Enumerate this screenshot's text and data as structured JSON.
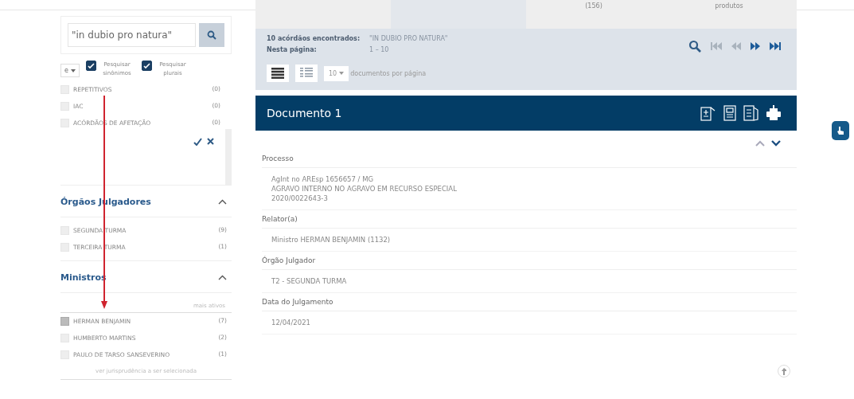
{
  "tabs": [
    {
      "label": "(156)",
      "selected": false
    },
    {
      "label": "produtos",
      "selected": false
    }
  ],
  "search": {
    "value": "\"in dubio pro natura\""
  },
  "search_options": {
    "operator": "e",
    "options": [
      {
        "label": "Pesquisar sinônimos",
        "checked": true
      },
      {
        "label": "Pesquisar plurais",
        "checked": true
      }
    ]
  },
  "filters": [
    {
      "label": "REPETITIVOS",
      "count": "(0)",
      "checked": false
    },
    {
      "label": "IAC",
      "count": "(0)",
      "checked": false
    },
    {
      "label": "ACÓRDÃOS DE AFETAÇÃO",
      "count": "(0)",
      "checked": false
    }
  ],
  "sections": [
    {
      "title": "Órgãos Julgadores",
      "expanded": true,
      "items": [
        {
          "label": "SEGUNDA TURMA",
          "count": "(9)",
          "checked": false
        },
        {
          "label": "TERCEIRA TURMA",
          "count": "(1)",
          "checked": false
        }
      ]
    },
    {
      "title": "Ministros",
      "expanded": true,
      "sort": "mais ativos",
      "items": [
        {
          "label": "HERMAN BENJAMIN",
          "count": "(7)",
          "checked": true
        },
        {
          "label": "HUMBERTO MARTINS",
          "count": "(2)",
          "checked": false
        },
        {
          "label": "PAULO DE TARSO SANSEVERINO",
          "count": "(1)",
          "checked": false
        }
      ],
      "footer": "ver jurisprudência a ser selecionada"
    }
  ],
  "summary": {
    "found_label": "10 acórdãos encontrados:",
    "query": "\"IN DUBIO PRO NATURA\"",
    "page_label": "Nesta página:",
    "range": "1 – 10"
  },
  "pager": [
    {
      "kind": "search",
      "disabled": false
    },
    {
      "kind": "first",
      "disabled": true
    },
    {
      "kind": "prev",
      "disabled": true
    },
    {
      "kind": "next",
      "disabled": false
    },
    {
      "kind": "last",
      "disabled": false
    }
  ],
  "toolbar": {
    "per_page": "10",
    "per_page_label": "documentos por página"
  },
  "document": {
    "title": "Documento 1",
    "fields": [
      {
        "label": "Processo",
        "lines": [
          "AgInt no AREsp 1656657 / MG",
          "AGRAVO INTERNO NO AGRAVO EM RECURSO ESPECIAL",
          "2020/0022643-3"
        ]
      },
      {
        "label": "Relator(a)",
        "lines": [
          "Ministro HERMAN BENJAMIN (1132)"
        ]
      },
      {
        "label": "Órgão Julgador",
        "lines": [
          "T2 - SEGUNDA TURMA"
        ]
      },
      {
        "label": "Data do Julgamento",
        "lines": [
          "12/04/2021"
        ]
      }
    ]
  }
}
